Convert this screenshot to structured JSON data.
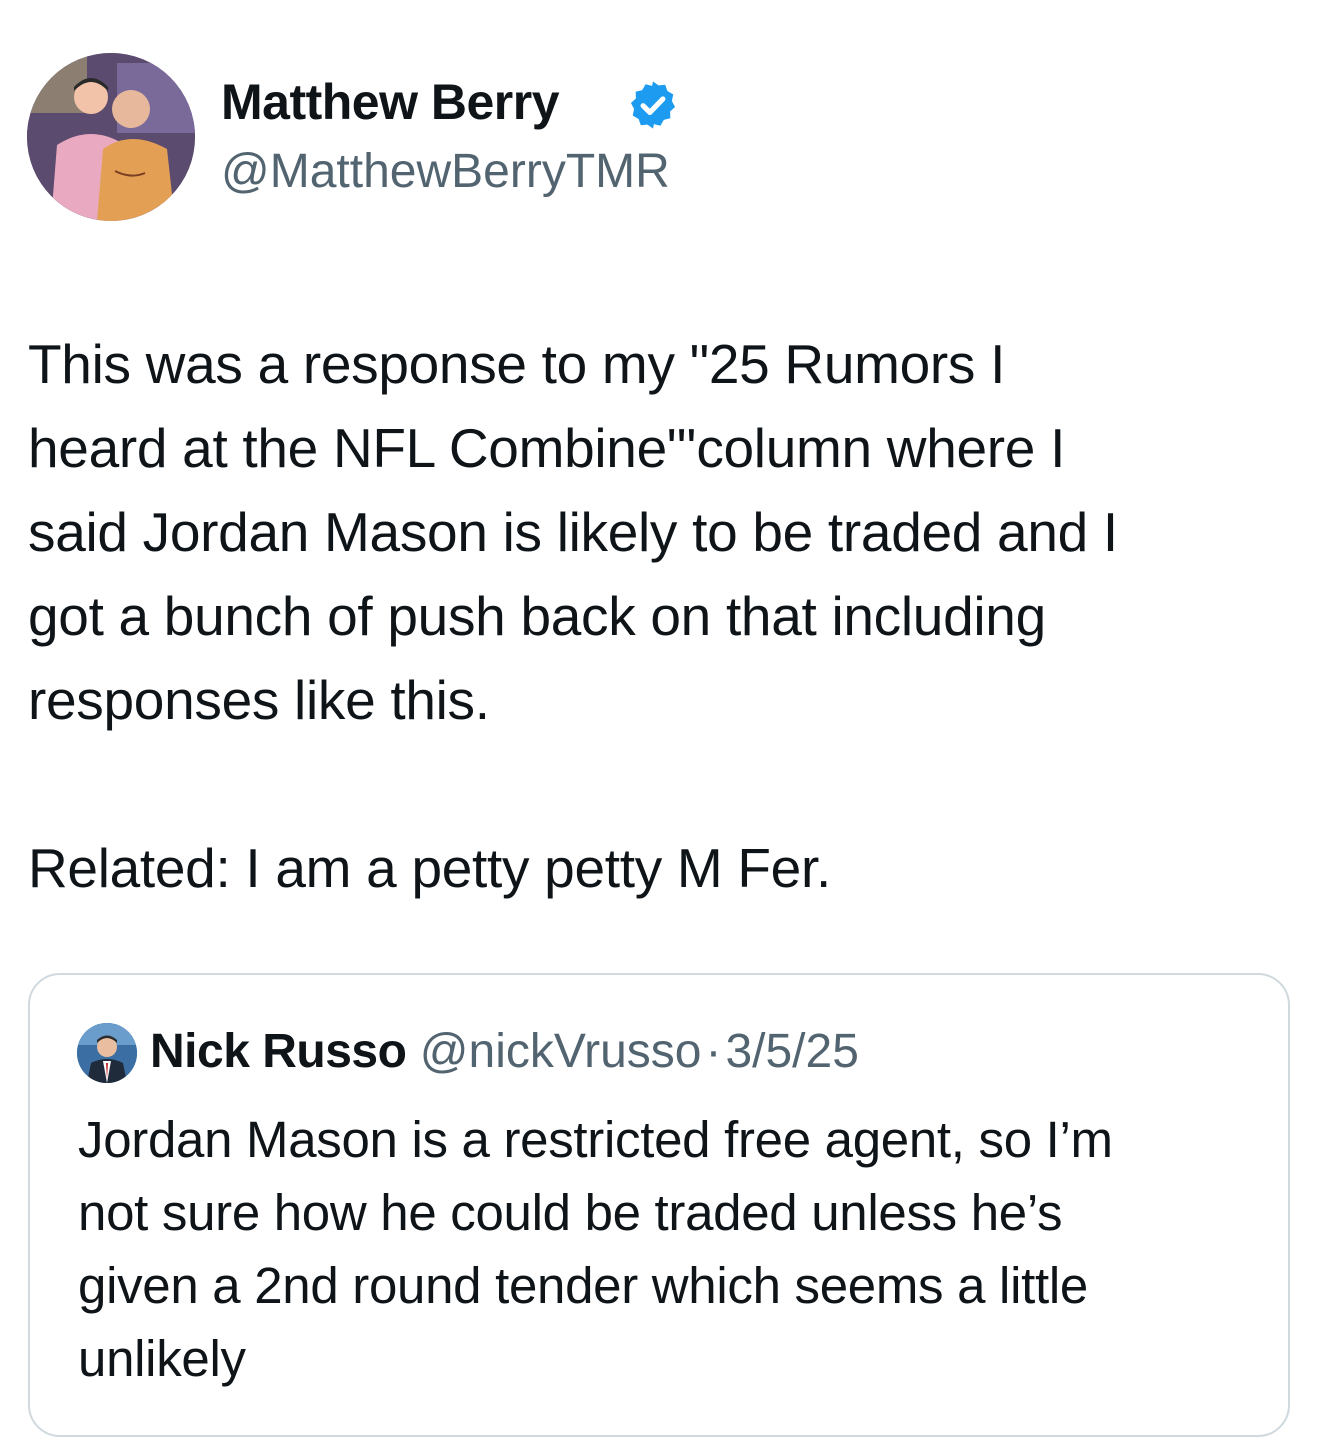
{
  "author": {
    "display_name": "Matthew Berry",
    "handle": "@MatthewBerryTMR",
    "avatar_icon": "profile-photo",
    "verified_icon": "verified-badge-icon",
    "verified_color": "#1d9bf0"
  },
  "tweet": {
    "lines": [
      "This was a response to my \"25 Rumors I",
      "heard at the NFL Combine\"'column where I",
      "said Jordan Mason is likely to be traded and I",
      "got a bunch of push back on that including",
      "responses like this."
    ],
    "related": "Related: I am a petty petty M Fer."
  },
  "quoted": {
    "display_name": "Nick Russo",
    "handle": "@nickVrusso",
    "separator": "·",
    "date": "3/5/25",
    "avatar_icon": "profile-photo",
    "lines": [
      "Jordan Mason is a restricted free agent, so I’m",
      "not sure how he could be traded unless he’s",
      "given a 2nd round tender which seems a little",
      "unlikely"
    ]
  },
  "colors": {
    "text": "#0f1419",
    "secondary": "#536471",
    "border": "#cfd9de"
  }
}
